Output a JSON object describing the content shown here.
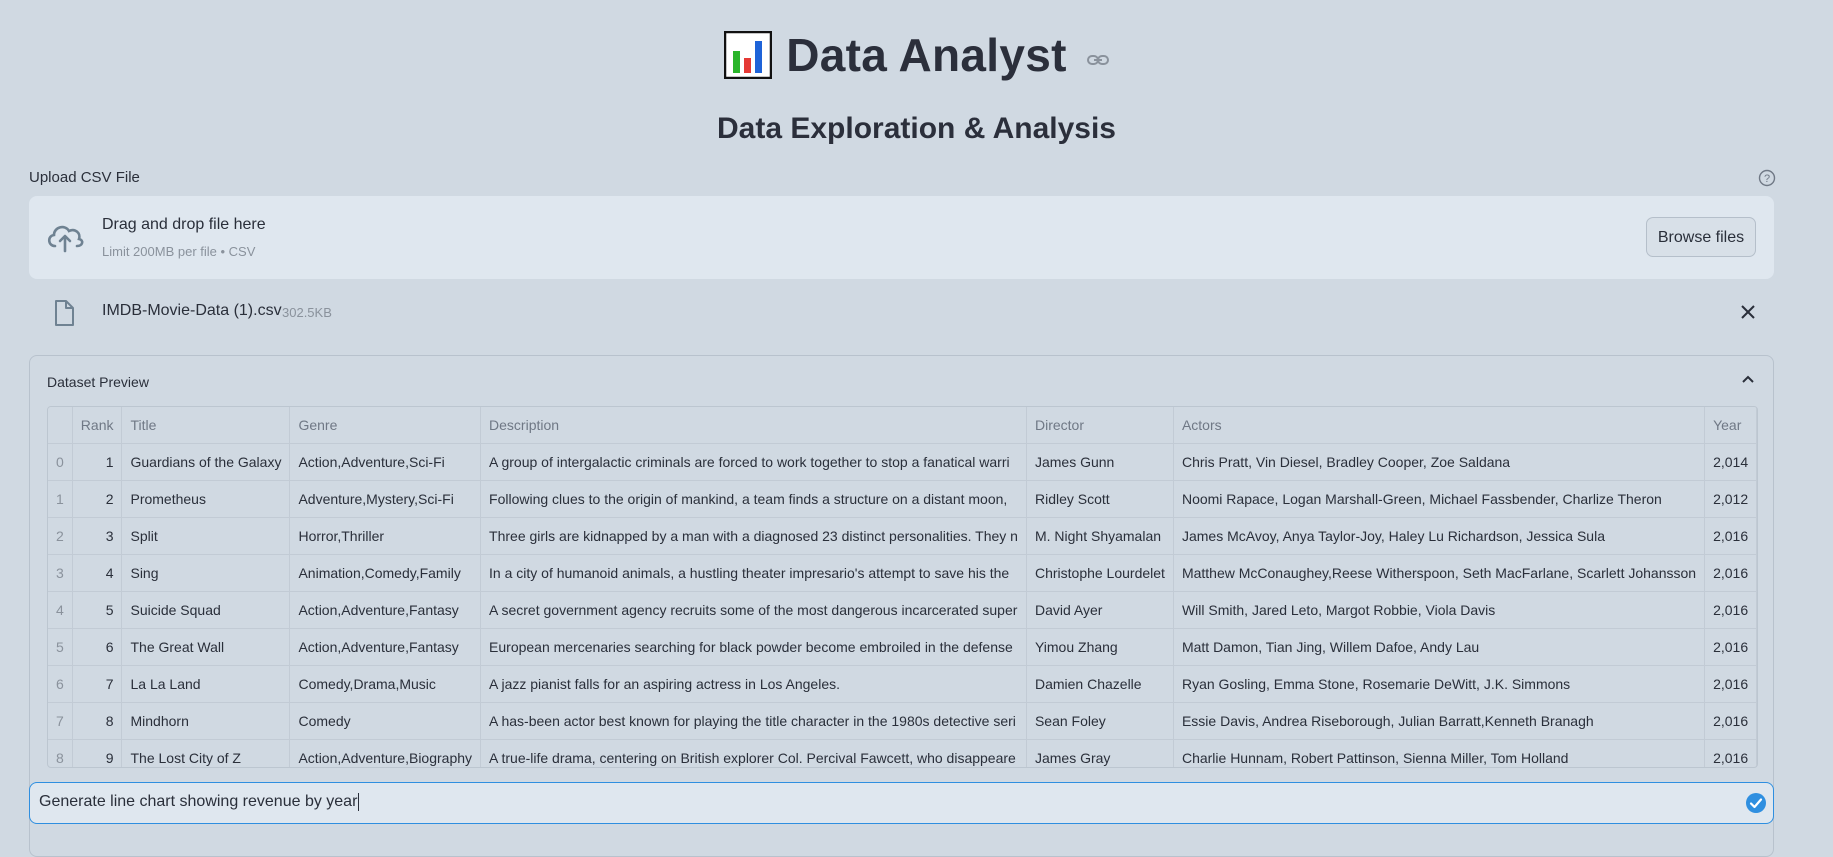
{
  "header": {
    "title": "Data Analyst",
    "subtitle": "Data Exploration & Analysis"
  },
  "uploader": {
    "label": "Upload CSV File",
    "drop_text": "Drag and drop file here",
    "limit_text": "Limit 200MB per file • CSV",
    "browse_label": "Browse files",
    "file_name": "IMDB-Movie-Data (1).csv",
    "file_size": "302.5KB"
  },
  "preview": {
    "title": "Dataset Preview",
    "columns": [
      "",
      "Rank",
      "Title",
      "Genre",
      "Description",
      "Director",
      "Actors",
      "Year"
    ],
    "rows": [
      [
        "0",
        "1",
        "Guardians of the Galaxy",
        "Action,Adventure,Sci-Fi",
        "A group of intergalactic criminals are forced to work together to stop a fanatical warri",
        "James Gunn",
        "Chris Pratt, Vin Diesel, Bradley Cooper, Zoe Saldana",
        "2,014"
      ],
      [
        "1",
        "2",
        "Prometheus",
        "Adventure,Mystery,Sci-Fi",
        "Following clues to the origin of mankind, a team finds a structure on a distant moon,",
        "Ridley Scott",
        "Noomi Rapace, Logan Marshall-Green, Michael Fassbender, Charlize Theron",
        "2,012"
      ],
      [
        "2",
        "3",
        "Split",
        "Horror,Thriller",
        "Three girls are kidnapped by a man with a diagnosed 23 distinct personalities. They n",
        "M. Night Shyamalan",
        "James McAvoy, Anya Taylor-Joy, Haley Lu Richardson, Jessica Sula",
        "2,016"
      ],
      [
        "3",
        "4",
        "Sing",
        "Animation,Comedy,Family",
        "In a city of humanoid animals, a hustling theater impresario's attempt to save his the",
        "Christophe Lourdelet",
        "Matthew McConaughey,Reese Witherspoon, Seth MacFarlane, Scarlett Johansson",
        "2,016"
      ],
      [
        "4",
        "5",
        "Suicide Squad",
        "Action,Adventure,Fantasy",
        "A secret government agency recruits some of the most dangerous incarcerated super",
        "David Ayer",
        "Will Smith, Jared Leto, Margot Robbie, Viola Davis",
        "2,016"
      ],
      [
        "5",
        "6",
        "The Great Wall",
        "Action,Adventure,Fantasy",
        "European mercenaries searching for black powder become embroiled in the defense",
        "Yimou Zhang",
        "Matt Damon, Tian Jing, Willem Dafoe, Andy Lau",
        "2,016"
      ],
      [
        "6",
        "7",
        "La La Land",
        "Comedy,Drama,Music",
        "A jazz pianist falls for an aspiring actress in Los Angeles.",
        "Damien Chazelle",
        "Ryan Gosling, Emma Stone, Rosemarie DeWitt, J.K. Simmons",
        "2,016"
      ],
      [
        "7",
        "8",
        "Mindhorn",
        "Comedy",
        "A has-been actor best known for playing the title character in the 1980s detective seri",
        "Sean Foley",
        "Essie Davis, Andrea Riseborough, Julian Barratt,Kenneth Branagh",
        "2,016"
      ],
      [
        "8",
        "9",
        "The Lost City of Z",
        "Action,Adventure,Biography",
        "A true-life drama, centering on British explorer Col. Percival Fawcett, who disappeare",
        "James Gray",
        "Charlie Hunnam, Robert Pattinson, Sienna Miller, Tom Holland",
        "2,016"
      ]
    ]
  },
  "chat": {
    "value": "Generate line chart showing revenue by year"
  },
  "colors": {
    "accent": "#2f8fe0",
    "background": "#d0d9e2",
    "surface": "#dfe7ef"
  },
  "icons": [
    "bar-chart-icon",
    "link-icon",
    "help-icon",
    "cloud-upload-icon",
    "file-icon",
    "close-icon",
    "chevron-up-icon",
    "send-icon"
  ]
}
